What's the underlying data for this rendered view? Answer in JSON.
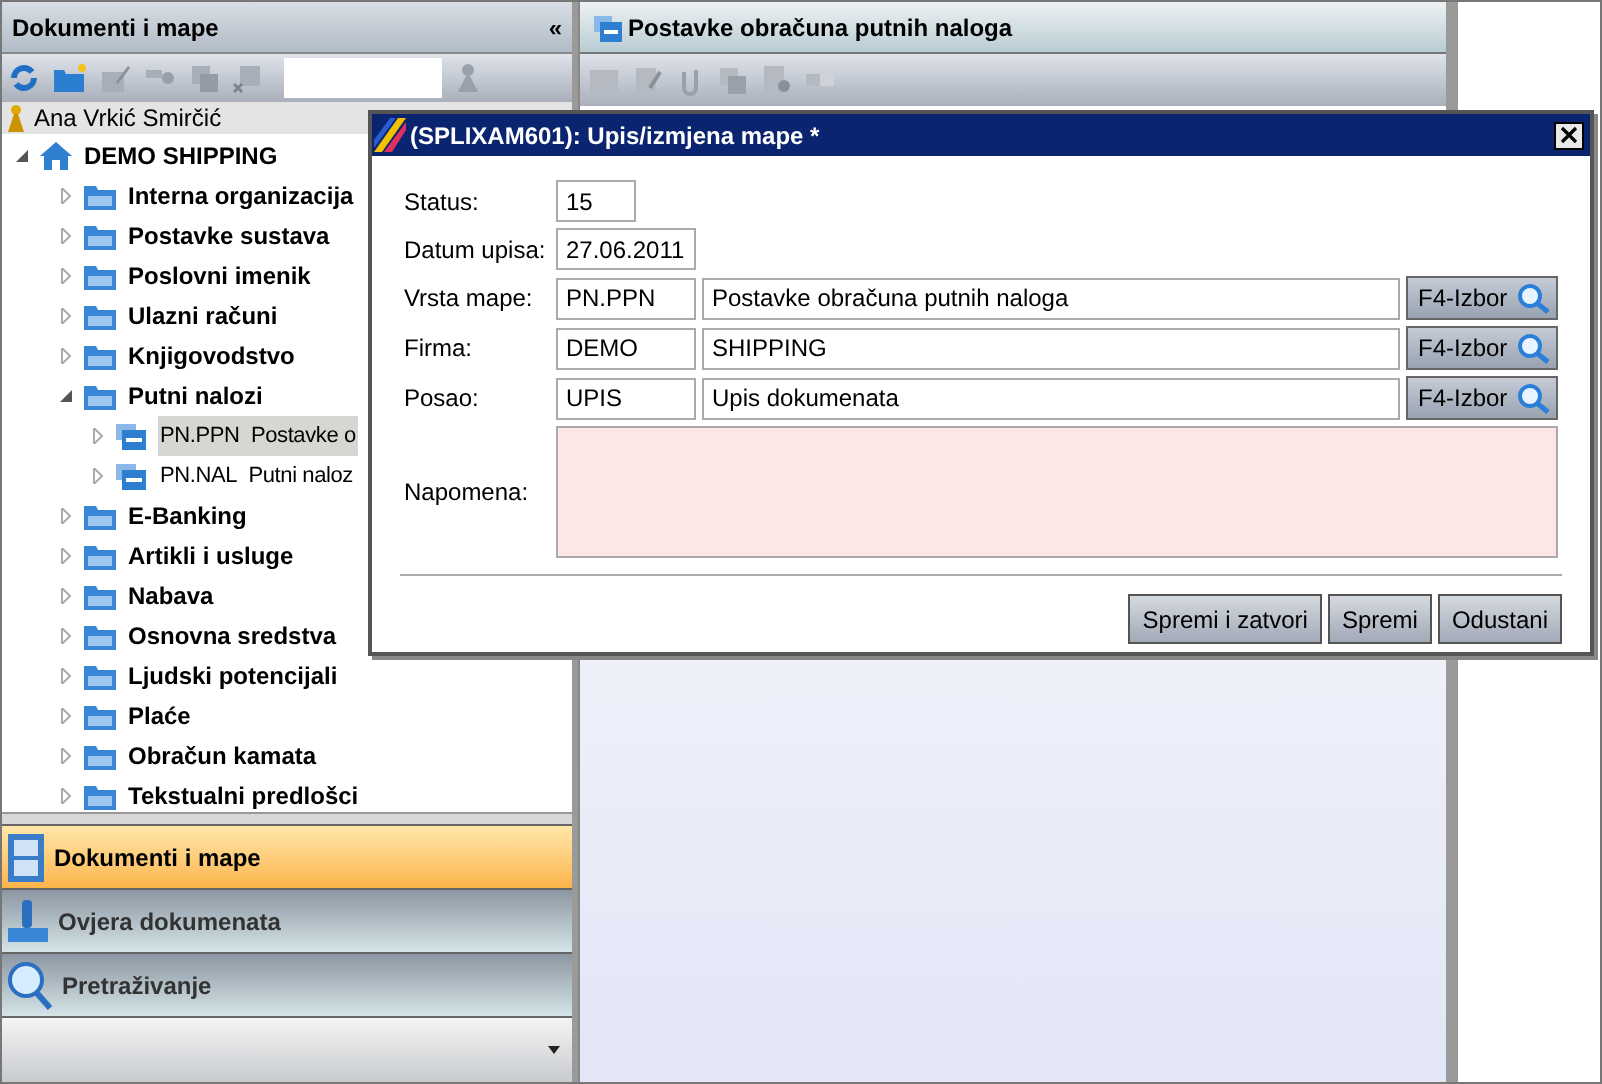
{
  "left_panel": {
    "title": "Dokumenti i mape",
    "collapse": "«",
    "user": "Ana Vrkić Smirčić",
    "tree": [
      {
        "label": "DEMO SHIPPING",
        "expanded": true,
        "selected": false,
        "children": [
          {
            "label": "Interna organizacija",
            "expanded": false,
            "selected": false
          },
          {
            "label": "Postavke sustava",
            "expanded": false,
            "selected": false
          },
          {
            "label": "Poslovni imenik",
            "expanded": false,
            "selected": false
          },
          {
            "label": "Ulazni računi",
            "expanded": false,
            "selected": false
          },
          {
            "label": "Knjigovodstvo",
            "expanded": false,
            "selected": false
          },
          {
            "label": "Putni nalozi",
            "expanded": true,
            "selected": false,
            "children": [
              {
                "code": "PN.PPN",
                "label": "Postavke o",
                "expanded": false,
                "selected": true
              },
              {
                "code": "PN.NAL",
                "label": "Putni naloz",
                "expanded": false,
                "selected": false
              }
            ]
          },
          {
            "label": "E-Banking",
            "expanded": false,
            "selected": false
          },
          {
            "label": "Artikli i usluge",
            "expanded": false,
            "selected": false
          },
          {
            "label": "Nabava",
            "expanded": false,
            "selected": false
          },
          {
            "label": "Osnovna sredstva",
            "expanded": false,
            "selected": false
          },
          {
            "label": "Ljudski potencijali",
            "expanded": false,
            "selected": false
          },
          {
            "label": "Plaće",
            "expanded": false,
            "selected": false
          },
          {
            "label": "Obračun kamata",
            "expanded": false,
            "selected": false
          },
          {
            "label": "Tekstualni predlošci",
            "expanded": false,
            "selected": false
          }
        ]
      }
    ],
    "nav": [
      {
        "label": "Dokumenti i mape",
        "selected": true
      },
      {
        "label": "Ovjera dokumenata",
        "selected": false
      },
      {
        "label": "Pretraživanje",
        "selected": false
      }
    ]
  },
  "main_panel": {
    "title": "Postavke obračuna putnih naloga"
  },
  "dialog": {
    "title": "(SPLIXAM601): Upis/izmjena mape *",
    "fields": [
      {
        "kind": "short",
        "label": "Status:",
        "value": "15"
      },
      {
        "kind": "date",
        "label": "Datum upisa:",
        "value": "27.06.2011"
      },
      {
        "kind": "lookup",
        "label": "Vrsta mape:",
        "code": "PN.PPN",
        "value": "Postavke obračuna putnih naloga",
        "button": "F4-Izbor"
      },
      {
        "kind": "lookup",
        "label": "Firma:",
        "code": "DEMO",
        "value": "SHIPPING",
        "button": "F4-Izbor"
      },
      {
        "kind": "lookup",
        "label": "Posao:",
        "code": "UPIS",
        "value": "Upis dokumenata",
        "button": "F4-Izbor"
      },
      {
        "kind": "memo",
        "label": "Napomena:"
      }
    ],
    "buttons": [
      "Spremi i zatvori",
      "Spremi",
      "Odustani"
    ]
  }
}
